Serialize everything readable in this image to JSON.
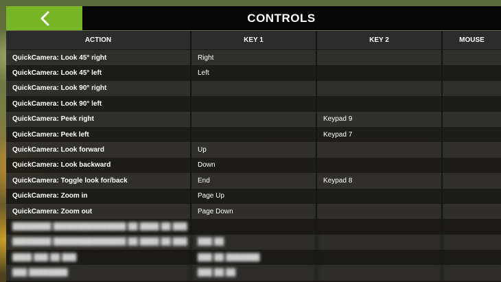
{
  "header": {
    "title": "CONTROLS",
    "back_icon": "chevron-left-icon",
    "accent_color": "#78b628"
  },
  "table": {
    "columns": [
      "ACTION",
      "KEY 1",
      "KEY 2",
      "MOUSE"
    ],
    "rows": [
      {
        "action": "QuickCamera: Look 45° right",
        "key1": "Right",
        "key2": "",
        "mouse": ""
      },
      {
        "action": "QuickCamera: Look 45° left",
        "key1": "Left",
        "key2": "",
        "mouse": ""
      },
      {
        "action": "QuickCamera: Look 90° right",
        "key1": "",
        "key2": "",
        "mouse": ""
      },
      {
        "action": "QuickCamera: Look 90° left",
        "key1": "",
        "key2": "",
        "mouse": ""
      },
      {
        "action": "QuickCamera: Peek right",
        "key1": "",
        "key2": "Keypad 9",
        "mouse": ""
      },
      {
        "action": "QuickCamera: Peek left",
        "key1": "",
        "key2": "Keypad 7",
        "mouse": ""
      },
      {
        "action": "QuickCamera: Look forward",
        "key1": "Up",
        "key2": "",
        "mouse": ""
      },
      {
        "action": "QuickCamera: Look backward",
        "key1": "Down",
        "key2": "",
        "mouse": ""
      },
      {
        "action": "QuickCamera: Toggle look for/back",
        "key1": "End",
        "key2": "Keypad 8",
        "mouse": ""
      },
      {
        "action": "QuickCamera: Zoom in",
        "key1": "Page Up",
        "key2": "",
        "mouse": ""
      },
      {
        "action": "QuickCamera: Zoom out",
        "key1": "Page Down",
        "key2": "",
        "mouse": ""
      }
    ],
    "blurred_rows": [
      {
        "action": "████████ ███████████████ ██ ████ ██ ███",
        "key1": "",
        "key2": "",
        "mouse": ""
      },
      {
        "action": "████████ ███████████████ ██ ████ ██ ███",
        "key1": "███ ██",
        "key2": "",
        "mouse": ""
      },
      {
        "action": "████ ███ ██ ███",
        "key1": "███ ██ ███████",
        "key2": "",
        "mouse": ""
      },
      {
        "action": "███ ████████",
        "key1": "███ ██ ██",
        "key2": "",
        "mouse": ""
      }
    ]
  }
}
